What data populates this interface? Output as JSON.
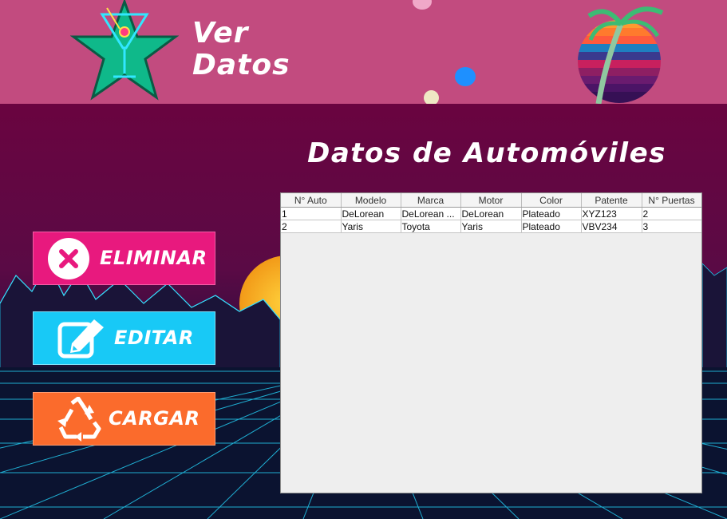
{
  "header": {
    "title_line1": "Ver",
    "title_line2": "Datos",
    "logo_text": "Cocktails"
  },
  "main": {
    "title": "Datos de Automóviles"
  },
  "buttons": {
    "eliminar": "ELIMINAR",
    "editar": "EDITAR",
    "cargar": "CARGAR"
  },
  "table": {
    "columns": [
      "N° Auto",
      "Modelo",
      "Marca",
      "Motor",
      "Color",
      "Patente",
      "N° Puertas"
    ],
    "rows": [
      [
        "1",
        "DeLorean",
        "DeLorean ...",
        "DeLorean",
        "Plateado",
        "XYZ123",
        "2"
      ],
      [
        "2",
        "Yaris",
        "Toyota",
        "Yaris",
        "Plateado",
        "VBV234",
        "3"
      ]
    ]
  },
  "colors": {
    "header_bg": "#c24b7f",
    "eliminar": "#e8197e",
    "editar": "#18c9f6",
    "cargar": "#fb6b2c"
  },
  "icons": {
    "eliminar": "close-circle-icon",
    "editar": "edit-icon",
    "cargar": "recycle-icon"
  }
}
